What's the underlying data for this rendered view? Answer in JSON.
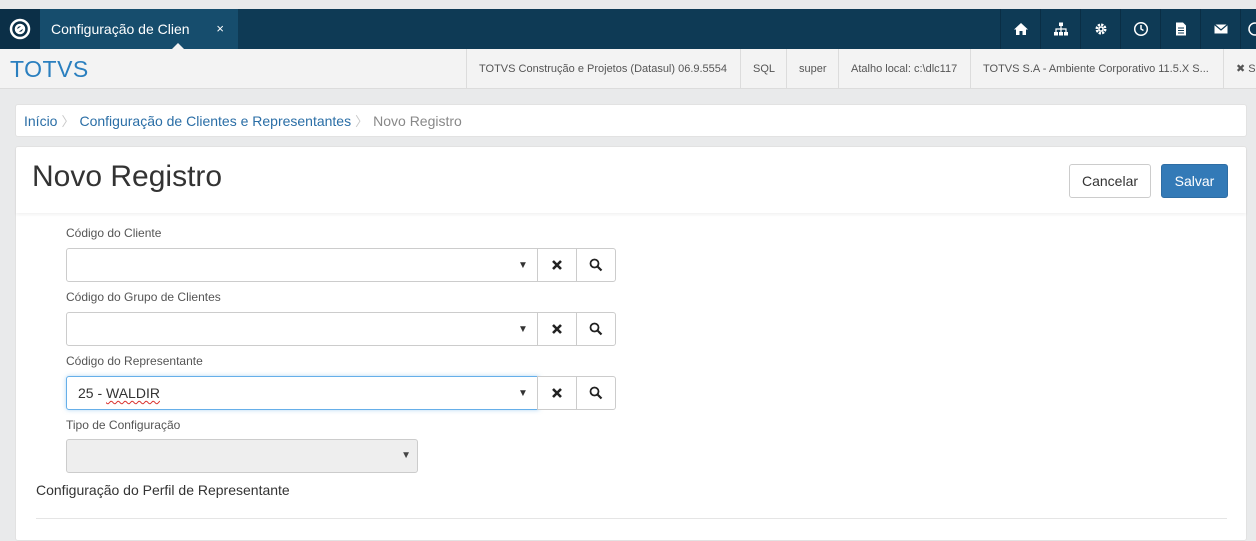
{
  "topbar": {
    "tab_label": "Configuração de Clien",
    "tab_close": "×",
    "icons": [
      "home-icon",
      "sitemap-icon",
      "gear-icon",
      "clock-icon",
      "document-icon",
      "mail-icon"
    ]
  },
  "header": {
    "brand": "TOTVS",
    "info": [
      "TOTVS Construção e Projetos (Datasul) 06.9.5554",
      "SQL",
      "super",
      "Atalho local: c:\\dlc117",
      "TOTVS S.A - Ambiente Corporativo 11.5.X S...",
      "✖ S"
    ]
  },
  "breadcrumb": {
    "items": [
      "Início",
      "Configuração de Clientes e Representantes"
    ],
    "current": "Novo Registro"
  },
  "page": {
    "title": "Novo Registro",
    "cancel_label": "Cancelar",
    "save_label": "Salvar"
  },
  "form": {
    "fields": [
      {
        "label": "Código do Cliente",
        "value": ""
      },
      {
        "label": "Código do Grupo de Clientes",
        "value": ""
      },
      {
        "label": "Código do Representante",
        "value_prefix": "25 - ",
        "value_name": "WALDIR"
      }
    ],
    "tipo_label": "Tipo de Configuração",
    "tipo_value": "",
    "section_title": "Configuração do Perfil de Representante"
  },
  "colors": {
    "topbar": "#0e3a55",
    "tab_active": "#164d6d",
    "brand": "#2a7fbf",
    "primary": "#337ab7"
  }
}
